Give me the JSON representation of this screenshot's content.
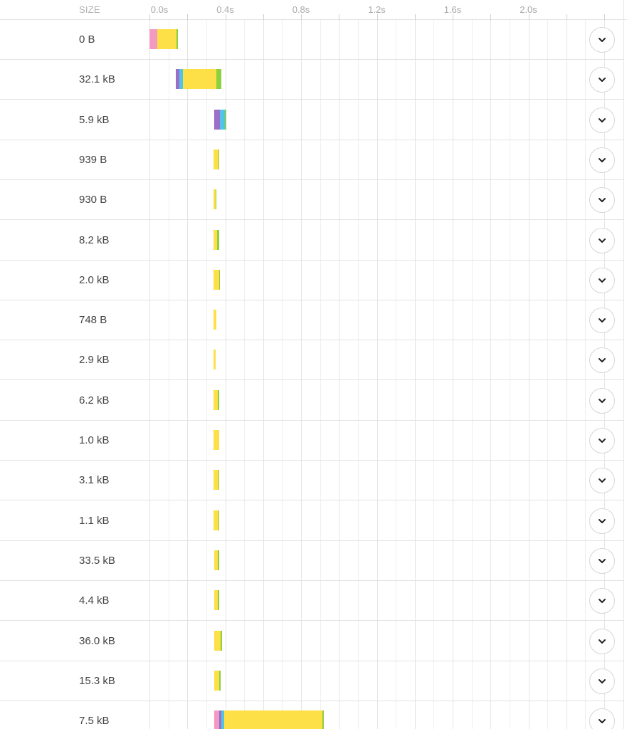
{
  "header": {
    "size_label": "SIZE"
  },
  "axis": {
    "ticks": [
      "0.0s",
      "0.4s",
      "0.8s",
      "1.2s",
      "1.6s",
      "2.0s"
    ]
  },
  "colors": {
    "blocked": "#f29ac2",
    "dns": "#9b6fc7",
    "connect": "#4fc3e8",
    "wait": "#fde047",
    "receive": "#8ccf3f"
  },
  "rows": [
    {
      "size": "0 B"
    },
    {
      "size": "32.1 kB"
    },
    {
      "size": "5.9 kB"
    },
    {
      "size": "939 B"
    },
    {
      "size": "930 B"
    },
    {
      "size": "8.2 kB"
    },
    {
      "size": "2.0 kB"
    },
    {
      "size": "748 B"
    },
    {
      "size": "2.9 kB"
    },
    {
      "size": "6.2 kB"
    },
    {
      "size": "1.0 kB"
    },
    {
      "size": "3.1 kB"
    },
    {
      "size": "1.1 kB"
    },
    {
      "size": "33.5 kB"
    },
    {
      "size": "4.4 kB"
    },
    {
      "size": "36.0 kB"
    },
    {
      "size": "15.3 kB"
    },
    {
      "size": "7.5 kB"
    }
  ],
  "expand_icon": "chevron-down-icon"
}
